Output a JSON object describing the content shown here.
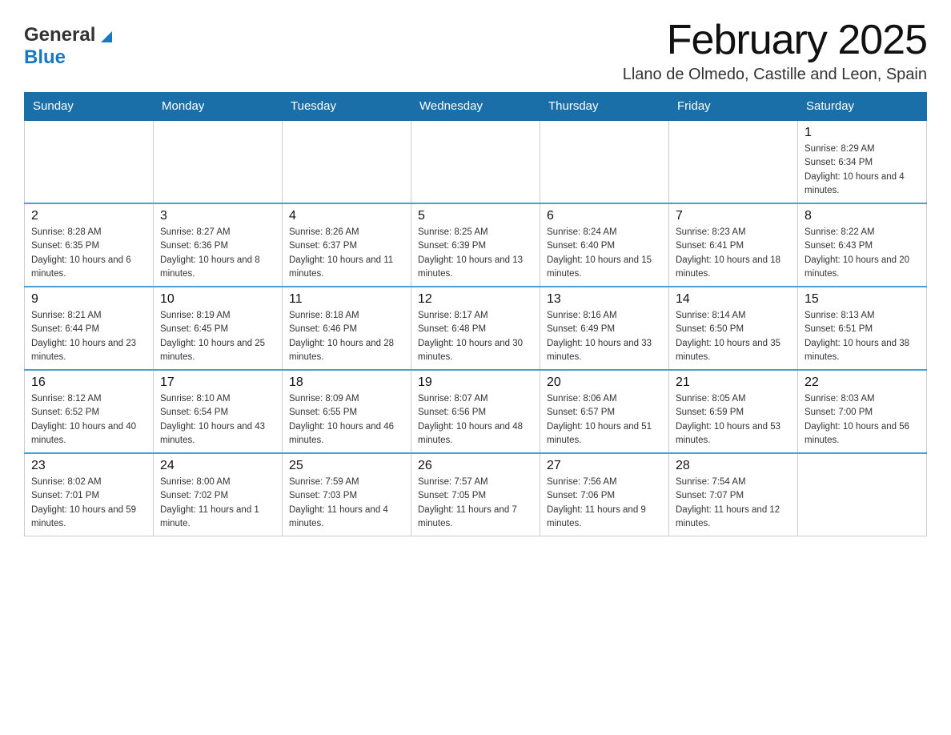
{
  "header": {
    "logo": {
      "general": "General",
      "blue": "Blue",
      "line2": "Blue"
    },
    "title": "February 2025",
    "location": "Llano de Olmedo, Castille and Leon, Spain"
  },
  "weekdays": [
    "Sunday",
    "Monday",
    "Tuesday",
    "Wednesday",
    "Thursday",
    "Friday",
    "Saturday"
  ],
  "weeks": [
    [
      {
        "day": "",
        "info": ""
      },
      {
        "day": "",
        "info": ""
      },
      {
        "day": "",
        "info": ""
      },
      {
        "day": "",
        "info": ""
      },
      {
        "day": "",
        "info": ""
      },
      {
        "day": "",
        "info": ""
      },
      {
        "day": "1",
        "info": "Sunrise: 8:29 AM\nSunset: 6:34 PM\nDaylight: 10 hours and 4 minutes."
      }
    ],
    [
      {
        "day": "2",
        "info": "Sunrise: 8:28 AM\nSunset: 6:35 PM\nDaylight: 10 hours and 6 minutes."
      },
      {
        "day": "3",
        "info": "Sunrise: 8:27 AM\nSunset: 6:36 PM\nDaylight: 10 hours and 8 minutes."
      },
      {
        "day": "4",
        "info": "Sunrise: 8:26 AM\nSunset: 6:37 PM\nDaylight: 10 hours and 11 minutes."
      },
      {
        "day": "5",
        "info": "Sunrise: 8:25 AM\nSunset: 6:39 PM\nDaylight: 10 hours and 13 minutes."
      },
      {
        "day": "6",
        "info": "Sunrise: 8:24 AM\nSunset: 6:40 PM\nDaylight: 10 hours and 15 minutes."
      },
      {
        "day": "7",
        "info": "Sunrise: 8:23 AM\nSunset: 6:41 PM\nDaylight: 10 hours and 18 minutes."
      },
      {
        "day": "8",
        "info": "Sunrise: 8:22 AM\nSunset: 6:43 PM\nDaylight: 10 hours and 20 minutes."
      }
    ],
    [
      {
        "day": "9",
        "info": "Sunrise: 8:21 AM\nSunset: 6:44 PM\nDaylight: 10 hours and 23 minutes."
      },
      {
        "day": "10",
        "info": "Sunrise: 8:19 AM\nSunset: 6:45 PM\nDaylight: 10 hours and 25 minutes."
      },
      {
        "day": "11",
        "info": "Sunrise: 8:18 AM\nSunset: 6:46 PM\nDaylight: 10 hours and 28 minutes."
      },
      {
        "day": "12",
        "info": "Sunrise: 8:17 AM\nSunset: 6:48 PM\nDaylight: 10 hours and 30 minutes."
      },
      {
        "day": "13",
        "info": "Sunrise: 8:16 AM\nSunset: 6:49 PM\nDaylight: 10 hours and 33 minutes."
      },
      {
        "day": "14",
        "info": "Sunrise: 8:14 AM\nSunset: 6:50 PM\nDaylight: 10 hours and 35 minutes."
      },
      {
        "day": "15",
        "info": "Sunrise: 8:13 AM\nSunset: 6:51 PM\nDaylight: 10 hours and 38 minutes."
      }
    ],
    [
      {
        "day": "16",
        "info": "Sunrise: 8:12 AM\nSunset: 6:52 PM\nDaylight: 10 hours and 40 minutes."
      },
      {
        "day": "17",
        "info": "Sunrise: 8:10 AM\nSunset: 6:54 PM\nDaylight: 10 hours and 43 minutes."
      },
      {
        "day": "18",
        "info": "Sunrise: 8:09 AM\nSunset: 6:55 PM\nDaylight: 10 hours and 46 minutes."
      },
      {
        "day": "19",
        "info": "Sunrise: 8:07 AM\nSunset: 6:56 PM\nDaylight: 10 hours and 48 minutes."
      },
      {
        "day": "20",
        "info": "Sunrise: 8:06 AM\nSunset: 6:57 PM\nDaylight: 10 hours and 51 minutes."
      },
      {
        "day": "21",
        "info": "Sunrise: 8:05 AM\nSunset: 6:59 PM\nDaylight: 10 hours and 53 minutes."
      },
      {
        "day": "22",
        "info": "Sunrise: 8:03 AM\nSunset: 7:00 PM\nDaylight: 10 hours and 56 minutes."
      }
    ],
    [
      {
        "day": "23",
        "info": "Sunrise: 8:02 AM\nSunset: 7:01 PM\nDaylight: 10 hours and 59 minutes."
      },
      {
        "day": "24",
        "info": "Sunrise: 8:00 AM\nSunset: 7:02 PM\nDaylight: 11 hours and 1 minute."
      },
      {
        "day": "25",
        "info": "Sunrise: 7:59 AM\nSunset: 7:03 PM\nDaylight: 11 hours and 4 minutes."
      },
      {
        "day": "26",
        "info": "Sunrise: 7:57 AM\nSunset: 7:05 PM\nDaylight: 11 hours and 7 minutes."
      },
      {
        "day": "27",
        "info": "Sunrise: 7:56 AM\nSunset: 7:06 PM\nDaylight: 11 hours and 9 minutes."
      },
      {
        "day": "28",
        "info": "Sunrise: 7:54 AM\nSunset: 7:07 PM\nDaylight: 11 hours and 12 minutes."
      },
      {
        "day": "",
        "info": ""
      }
    ]
  ]
}
